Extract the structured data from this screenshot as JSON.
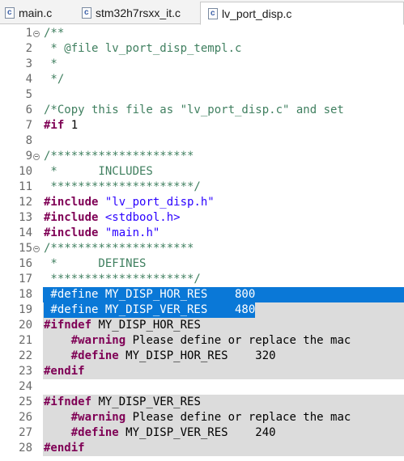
{
  "tabs": [
    {
      "label": "main.c",
      "active": false
    },
    {
      "label": "stm32h7rsxx_it.c",
      "active": false
    },
    {
      "label": "lv_port_disp.c",
      "active": true
    }
  ],
  "tab_icon_letter": "c",
  "colors": {
    "comment": "#3f7f5f",
    "keyword": "#7f0055",
    "string": "#2a00ff",
    "selection": "#0a78d7",
    "inactive_block": "#dcdcdc"
  },
  "editor": {
    "lines": [
      {
        "num": "1",
        "fold": true,
        "tokens": [
          {
            "t": "/**",
            "c": "comment"
          }
        ]
      },
      {
        "num": "2",
        "tokens": [
          {
            "t": " * @file lv_port_disp_templ.c",
            "c": "comment"
          }
        ]
      },
      {
        "num": "3",
        "tokens": [
          {
            "t": " *",
            "c": "comment"
          }
        ]
      },
      {
        "num": "4",
        "tokens": [
          {
            "t": " */",
            "c": "comment"
          }
        ]
      },
      {
        "num": "5",
        "tokens": []
      },
      {
        "num": "6",
        "tokens": [
          {
            "t": "/*Copy this file as \"lv_port_disp.c\" and set",
            "c": "comment"
          }
        ]
      },
      {
        "num": "7",
        "tokens": [
          {
            "t": "#if",
            "c": "kw"
          },
          {
            "t": " 1",
            "c": "text"
          }
        ]
      },
      {
        "num": "8",
        "tokens": []
      },
      {
        "num": "9",
        "fold": true,
        "tokens": [
          {
            "t": "/*********************",
            "c": "comment"
          }
        ]
      },
      {
        "num": "10",
        "tokens": [
          {
            "t": " *      INCLUDES",
            "c": "comment"
          }
        ]
      },
      {
        "num": "11",
        "tokens": [
          {
            "t": " *********************/",
            "c": "comment"
          }
        ]
      },
      {
        "num": "12",
        "tokens": [
          {
            "t": "#include",
            "c": "kw"
          },
          {
            "t": " \"lv_port_disp.h\"",
            "c": "str"
          }
        ]
      },
      {
        "num": "13",
        "tokens": [
          {
            "t": "#include",
            "c": "kw"
          },
          {
            "t": " <stdbool.h>",
            "c": "str"
          }
        ]
      },
      {
        "num": "14",
        "tokens": [
          {
            "t": "#include",
            "c": "kw"
          },
          {
            "t": " \"main.h\"",
            "c": "str"
          }
        ]
      },
      {
        "num": "15",
        "fold": true,
        "tokens": [
          {
            "t": "/*********************",
            "c": "comment"
          }
        ]
      },
      {
        "num": "16",
        "tokens": [
          {
            "t": " *      DEFINES",
            "c": "comment"
          }
        ]
      },
      {
        "num": "17",
        "tokens": [
          {
            "t": " *********************/",
            "c": "comment"
          }
        ]
      },
      {
        "num": "18",
        "bg": "selected",
        "tokens": [
          {
            "t": " #define MY_DISP_HOR_RES    800",
            "c": "text"
          }
        ]
      },
      {
        "num": "19",
        "bg": "selected-partial",
        "tokens": [
          {
            "t": " #define MY_DISP_VER_RES    480",
            "c": "text"
          }
        ]
      },
      {
        "num": "20",
        "bg": "shaded",
        "tokens": [
          {
            "t": "#ifndef",
            "c": "kw"
          },
          {
            "t": " MY_DISP_HOR_RES",
            "c": "text"
          }
        ]
      },
      {
        "num": "21",
        "bg": "shaded",
        "tokens": [
          {
            "t": "    ",
            "c": "text"
          },
          {
            "t": "#warning",
            "c": "kw"
          },
          {
            "t": " Please define or replace the mac",
            "c": "text"
          }
        ]
      },
      {
        "num": "22",
        "bg": "shaded",
        "tokens": [
          {
            "t": "    ",
            "c": "text"
          },
          {
            "t": "#define",
            "c": "kw"
          },
          {
            "t": " MY_DISP_HOR_RES    320",
            "c": "text"
          }
        ]
      },
      {
        "num": "23",
        "bg": "shaded",
        "tokens": [
          {
            "t": "#endif",
            "c": "kw"
          }
        ]
      },
      {
        "num": "24",
        "tokens": []
      },
      {
        "num": "25",
        "bg": "shaded",
        "tokens": [
          {
            "t": "#ifndef",
            "c": "kw"
          },
          {
            "t": " MY_DISP_VER_RES",
            "c": "text"
          }
        ]
      },
      {
        "num": "26",
        "bg": "shaded",
        "tokens": [
          {
            "t": "    ",
            "c": "text"
          },
          {
            "t": "#warning",
            "c": "kw"
          },
          {
            "t": " Please define or replace the mac",
            "c": "text"
          }
        ]
      },
      {
        "num": "27",
        "bg": "shaded",
        "tokens": [
          {
            "t": "    ",
            "c": "text"
          },
          {
            "t": "#define",
            "c": "kw"
          },
          {
            "t": " MY_DISP_VER_RES    240",
            "c": "text"
          }
        ]
      },
      {
        "num": "28",
        "bg": "shaded",
        "tokens": [
          {
            "t": "#endif",
            "c": "kw"
          }
        ]
      }
    ]
  }
}
